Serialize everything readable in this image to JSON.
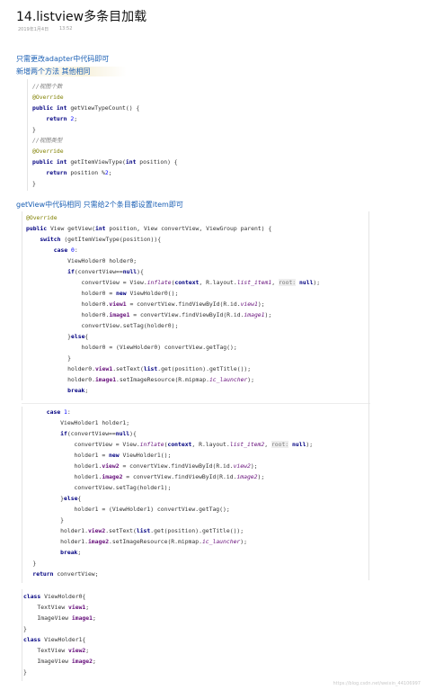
{
  "article": {
    "title": "14.listview多条目加载",
    "date": "2019年1月4日",
    "time": "13:52"
  },
  "headings": {
    "h1": "只需更改adapter中代码即可",
    "h2": "新增两个方法 其他相同",
    "h3": "getView中代码相同 只需给2个条目都设置item即可"
  },
  "watermark": "https://blog.csdn.net/weixin_44106997",
  "code1": [
    {
      "spans": [
        {
          "c": "cm",
          "t": "//视图个数"
        }
      ]
    },
    {
      "spans": [
        {
          "c": "an",
          "t": "@Override"
        }
      ]
    },
    {
      "spans": [
        {
          "c": "kw",
          "t": "public int"
        },
        {
          "t": " getViewTypeCount() {"
        }
      ]
    },
    {
      "spans": [
        {
          "t": "    "
        },
        {
          "c": "kw",
          "t": "return"
        },
        {
          "t": " "
        },
        {
          "c": "nu",
          "t": "2"
        },
        {
          "t": ";"
        }
      ]
    },
    {
      "spans": [
        {
          "t": "}"
        }
      ]
    },
    {
      "spans": [
        {
          "c": "cm",
          "t": "//视图类型"
        }
      ]
    },
    {
      "spans": [
        {
          "c": "an",
          "t": "@Override"
        }
      ]
    },
    {
      "spans": [
        {
          "c": "kw",
          "t": "public int"
        },
        {
          "t": " getItemViewType("
        },
        {
          "c": "kw",
          "t": "int"
        },
        {
          "t": " position) {"
        }
      ]
    },
    {
      "spans": [
        {
          "t": "    "
        },
        {
          "c": "kw",
          "t": "return"
        },
        {
          "t": " position %"
        },
        {
          "c": "nu",
          "t": "2"
        },
        {
          "t": ";"
        }
      ]
    },
    {
      "spans": [
        {
          "t": "}"
        }
      ]
    }
  ],
  "code2": [
    {
      "spans": [
        {
          "c": "an",
          "t": "@Override"
        }
      ]
    },
    {
      "spans": [
        {
          "c": "kw",
          "t": "public"
        },
        {
          "t": " View getView("
        },
        {
          "c": "kw",
          "t": "int"
        },
        {
          "t": " position, View convertView, ViewGroup parent) {"
        }
      ]
    },
    {
      "spans": [
        {
          "t": "    "
        },
        {
          "c": "kw",
          "t": "switch"
        },
        {
          "t": " (getItemViewType(position)){"
        }
      ]
    },
    {
      "spans": [
        {
          "t": "        "
        },
        {
          "c": "kw",
          "t": "case"
        },
        {
          "t": " "
        },
        {
          "c": "nu",
          "t": "0"
        },
        {
          "t": ":"
        }
      ]
    },
    {
      "spans": [
        {
          "t": "            ViewHolder0 holder0;"
        }
      ]
    },
    {
      "spans": [
        {
          "t": "            "
        },
        {
          "c": "kw",
          "t": "if"
        },
        {
          "t": "(convertView=="
        },
        {
          "c": "kw",
          "t": "null"
        },
        {
          "t": "){"
        }
      ]
    },
    {
      "spans": [
        {
          "t": "                convertView = View."
        },
        {
          "c": "it",
          "t": "inflate"
        },
        {
          "t": "("
        },
        {
          "c": "kw",
          "t": "context"
        },
        {
          "t": ", R.layout."
        },
        {
          "c": "it",
          "t": "list_item1"
        },
        {
          "t": ", "
        },
        {
          "c": "hint",
          "t": "root:"
        },
        {
          "t": " "
        },
        {
          "c": "kw",
          "t": "null"
        },
        {
          "t": ");"
        }
      ]
    },
    {
      "spans": [
        {
          "t": "                holder0 = "
        },
        {
          "c": "kw",
          "t": "new"
        },
        {
          "t": " ViewHolder0();"
        }
      ]
    },
    {
      "spans": [
        {
          "t": "                holder0."
        },
        {
          "c": "fd",
          "t": "view1"
        },
        {
          "t": " = convertView.findViewById(R.id."
        },
        {
          "c": "it",
          "t": "view1"
        },
        {
          "t": ");"
        }
      ]
    },
    {
      "spans": [
        {
          "t": "                holder0."
        },
        {
          "c": "fd",
          "t": "image1"
        },
        {
          "t": " = convertView.findViewById(R.id."
        },
        {
          "c": "it",
          "t": "image1"
        },
        {
          "t": ");"
        }
      ]
    },
    {
      "spans": [
        {
          "t": "                convertView.setTag(holder0);"
        }
      ]
    },
    {
      "spans": [
        {
          "t": "            }"
        },
        {
          "c": "kw",
          "t": "else"
        },
        {
          "t": "{"
        }
      ]
    },
    {
      "spans": [
        {
          "t": "                holder0 = (ViewHolder0) convertView.getTag();"
        }
      ]
    },
    {
      "spans": [
        {
          "t": "            }"
        }
      ]
    },
    {
      "spans": [
        {
          "t": "            holder0."
        },
        {
          "c": "fd",
          "t": "view1"
        },
        {
          "t": ".setText("
        },
        {
          "c": "kw",
          "t": "list"
        },
        {
          "t": ".get(position).getTitle());"
        }
      ]
    },
    {
      "spans": [
        {
          "t": "            holder0."
        },
        {
          "c": "fd",
          "t": "image1"
        },
        {
          "t": ".setImageResource(R.mipmap."
        },
        {
          "c": "it",
          "t": "ic_launcher"
        },
        {
          "t": ");"
        }
      ]
    },
    {
      "spans": [
        {
          "t": "            "
        },
        {
          "c": "kw",
          "t": "break"
        },
        {
          "t": ";"
        }
      ]
    }
  ],
  "code3": [
    {
      "spans": [
        {
          "t": "        "
        },
        {
          "c": "kw",
          "t": "case"
        },
        {
          "t": " "
        },
        {
          "c": "nu",
          "t": "1"
        },
        {
          "t": ":"
        }
      ]
    },
    {
      "spans": [
        {
          "t": "            ViewHolder1 holder1;"
        }
      ]
    },
    {
      "spans": [
        {
          "t": "            "
        },
        {
          "c": "kw",
          "t": "if"
        },
        {
          "t": "(convertView=="
        },
        {
          "c": "kw",
          "t": "null"
        },
        {
          "t": "){"
        }
      ]
    },
    {
      "spans": [
        {
          "t": "                convertView = View."
        },
        {
          "c": "it",
          "t": "inflate"
        },
        {
          "t": "("
        },
        {
          "c": "kw",
          "t": "context"
        },
        {
          "t": ", R.layout."
        },
        {
          "c": "it",
          "t": "list_item2"
        },
        {
          "t": ", "
        },
        {
          "c": "hint",
          "t": "root:"
        },
        {
          "t": " "
        },
        {
          "c": "kw",
          "t": "null"
        },
        {
          "t": ");"
        }
      ]
    },
    {
      "spans": [
        {
          "t": "                holder1 = "
        },
        {
          "c": "kw",
          "t": "new"
        },
        {
          "t": " ViewHolder1();"
        }
      ]
    },
    {
      "spans": [
        {
          "t": "                holder1."
        },
        {
          "c": "fd",
          "t": "view2"
        },
        {
          "t": " = convertView.findViewById(R.id."
        },
        {
          "c": "it",
          "t": "view2"
        },
        {
          "t": ");"
        }
      ]
    },
    {
      "spans": [
        {
          "t": "                holder1."
        },
        {
          "c": "fd",
          "t": "image2"
        },
        {
          "t": " = convertView.findViewById(R.id."
        },
        {
          "c": "it",
          "t": "image2"
        },
        {
          "t": ");"
        }
      ]
    },
    {
      "spans": [
        {
          "t": "                convertView.setTag(holder1);"
        }
      ]
    },
    {
      "spans": [
        {
          "t": "            }"
        },
        {
          "c": "kw",
          "t": "else"
        },
        {
          "t": "{"
        }
      ]
    },
    {
      "spans": [
        {
          "t": "                holder1 = (ViewHolder1) convertView.getTag();"
        }
      ]
    },
    {
      "spans": [
        {
          "t": "            }"
        }
      ]
    },
    {
      "spans": [
        {
          "t": "            holder1."
        },
        {
          "c": "fd",
          "t": "view2"
        },
        {
          "t": ".setText("
        },
        {
          "c": "kw",
          "t": "list"
        },
        {
          "t": ".get(position).getTitle());"
        }
      ]
    },
    {
      "spans": [
        {
          "t": "            holder1."
        },
        {
          "c": "fd",
          "t": "image2"
        },
        {
          "t": ".setImageResource(R.mipmap."
        },
        {
          "c": "it",
          "t": "ic_launcher"
        },
        {
          "t": ");"
        }
      ]
    },
    {
      "spans": [
        {
          "t": "            "
        },
        {
          "c": "kw",
          "t": "break"
        },
        {
          "t": ";"
        }
      ]
    },
    {
      "spans": [
        {
          "t": "    }"
        }
      ]
    },
    {
      "spans": [
        {
          "t": "    "
        },
        {
          "c": "kw",
          "t": "return"
        },
        {
          "t": " convertView;"
        }
      ]
    }
  ],
  "code4": [
    {
      "spans": [
        {
          "c": "kw",
          "t": "class"
        },
        {
          "t": " ViewHolder0{"
        }
      ]
    },
    {
      "spans": [
        {
          "t": "    TextView "
        },
        {
          "c": "fd",
          "t": "view1"
        },
        {
          "t": ";"
        }
      ]
    },
    {
      "spans": [
        {
          "t": "    ImageView "
        },
        {
          "c": "fd",
          "t": "image1"
        },
        {
          "t": ";"
        }
      ]
    },
    {
      "spans": [
        {
          "t": "}"
        }
      ]
    },
    {
      "spans": [
        {
          "c": "kw",
          "t": "class"
        },
        {
          "t": " ViewHolder1{"
        }
      ]
    },
    {
      "spans": [
        {
          "t": "    TextView "
        },
        {
          "c": "fd",
          "t": "view2"
        },
        {
          "t": ";"
        }
      ]
    },
    {
      "spans": [
        {
          "t": "    ImageView "
        },
        {
          "c": "fd",
          "t": "image2"
        },
        {
          "t": ";"
        }
      ]
    },
    {
      "spans": [
        {
          "t": "}"
        }
      ]
    }
  ]
}
